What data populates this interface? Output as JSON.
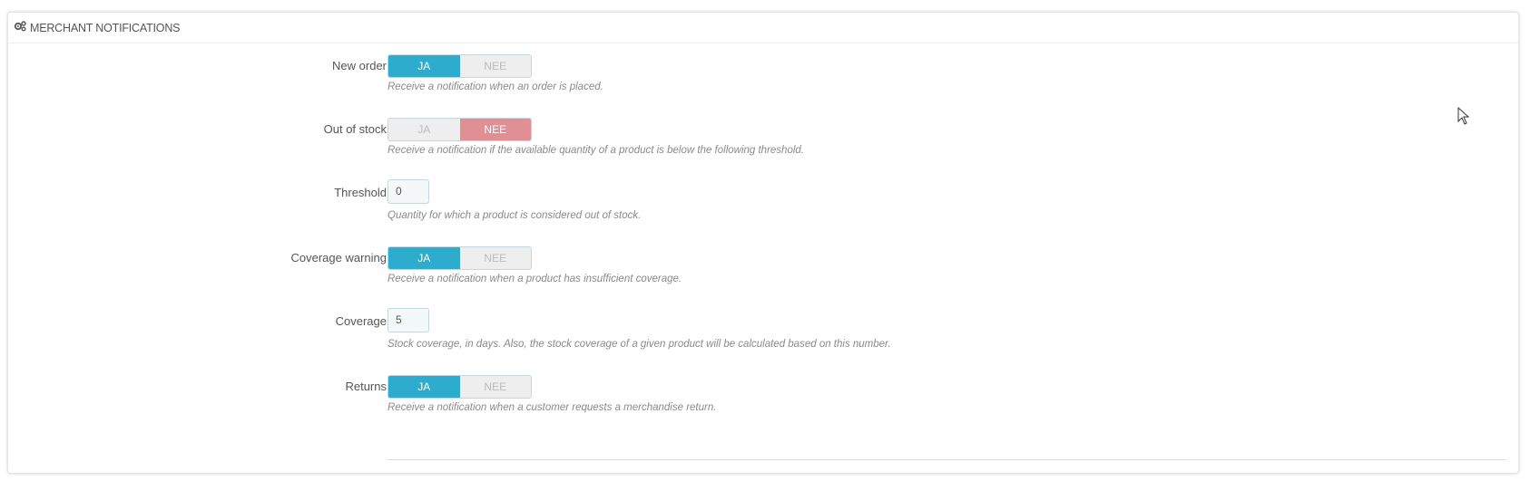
{
  "panel": {
    "title": "MERCHANT NOTIFICATIONS",
    "icon": "cogs-icon"
  },
  "fields": {
    "new_order": {
      "label": "New order",
      "yes": "JA",
      "no": "NEE",
      "value": "yes",
      "help": "Receive a notification when an order is placed."
    },
    "out_of_stock": {
      "label": "Out of stock",
      "yes": "JA",
      "no": "NEE",
      "value": "no",
      "help": "Receive a notification if the available quantity of a product is below the following threshold."
    },
    "threshold": {
      "label": "Threshold",
      "value": "0",
      "help": "Quantity for which a product is considered out of stock."
    },
    "coverage_warning": {
      "label": "Coverage warning",
      "yes": "JA",
      "no": "NEE",
      "value": "yes",
      "help": "Receive a notification when a product has insufficient coverage."
    },
    "coverage": {
      "label": "Coverage",
      "value": "5",
      "help": "Stock coverage, in days. Also, the stock coverage of a given product will be calculated based on this number."
    },
    "returns": {
      "label": "Returns",
      "yes": "JA",
      "no": "NEE",
      "value": "yes",
      "help": "Receive a notification when a customer requests a merchandise return."
    }
  },
  "colors": {
    "active_yes": "#2eacce",
    "active_no": "#e08f95",
    "inactive": "#eeeeee"
  }
}
